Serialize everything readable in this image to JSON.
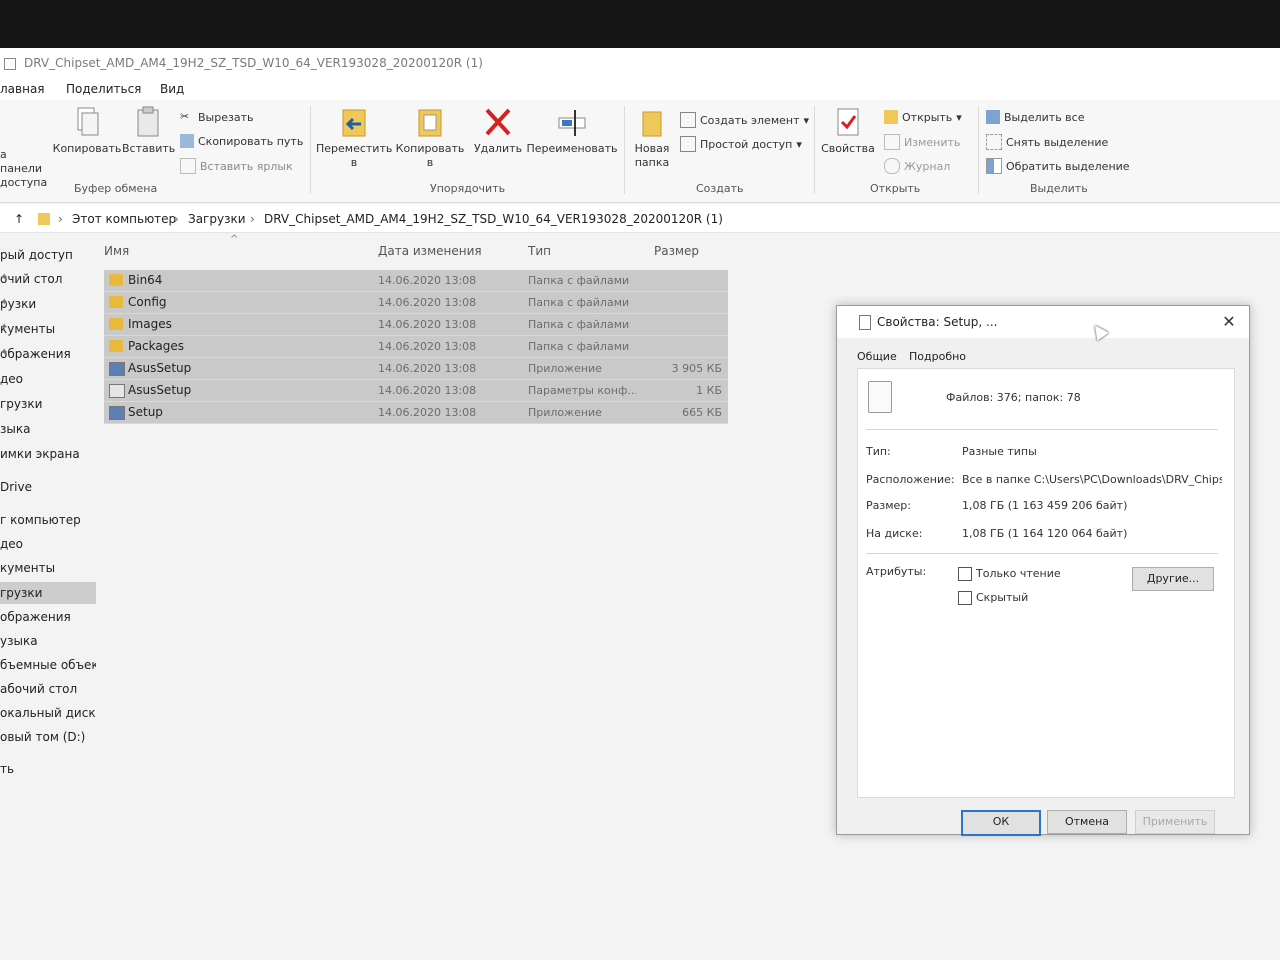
{
  "window": {
    "title": "DRV_Chipset_AMD_AM4_19H2_SZ_TSD_W10_64_VER193028_20200120R (1)"
  },
  "menu_tabs": [
    "лавная",
    "Поделиться",
    "Вид"
  ],
  "ribbon": {
    "clipboard": {
      "pin_label": "а панели доступа",
      "copy_label": "Копировать",
      "paste_label": "Вставить",
      "cut_label": "Вырезать",
      "copy_path_label": "Скопировать путь",
      "paste_shortcut_label": "Вставить ярлык",
      "group_label": "Буфер обмена"
    },
    "organize": {
      "move_label": "Переместить в",
      "copy_to_label": "Копировать в",
      "delete_label": "Удалить",
      "rename_label": "Переименовать",
      "group_label": "Упорядочить"
    },
    "create": {
      "new_folder_label": "Новая папка",
      "new_item_label": "Создать элемент",
      "easy_access_label": "Простой доступ",
      "group_label": "Создать"
    },
    "open": {
      "properties_label": "Свойства",
      "open_label": "Открыть",
      "edit_label": "Изменить",
      "history_label": "Журнал",
      "group_label": "Открыть"
    },
    "select": {
      "select_all_label": "Выделить все",
      "select_none_label": "Снять выделение",
      "invert_label": "Обратить выделение",
      "group_label": "Выделить"
    }
  },
  "address": {
    "crumbs": [
      "Этот компьютер",
      "Загрузки",
      "DRV_Chipset_AMD_AM4_19H2_SZ_TSD_W10_64_VER193028_20200120R (1)"
    ]
  },
  "nav": {
    "items": [
      {
        "label": "рый доступ",
        "pinned": false
      },
      {
        "label": "очий стол",
        "pinned": true
      },
      {
        "label": "рузки",
        "pinned": true
      },
      {
        "label": "кументы",
        "pinned": true
      },
      {
        "label": "ображения",
        "pinned": true
      },
      {
        "label": "део",
        "pinned": false
      },
      {
        "label": "грузки",
        "pinned": false
      },
      {
        "label": "зыка",
        "pinned": false
      },
      {
        "label": "имки экрана",
        "pinned": false
      },
      {
        "label": "Drive",
        "pinned": false
      },
      {
        "label": "г компьютер",
        "pinned": false
      },
      {
        "label": "део",
        "pinned": false
      },
      {
        "label": "кументы",
        "pinned": false
      },
      {
        "label": "грузки",
        "pinned": false
      },
      {
        "label": "ображения",
        "pinned": false
      },
      {
        "label": "узыка",
        "pinned": false
      },
      {
        "label": "бъемные объекты",
        "pinned": false
      },
      {
        "label": "абочий стол",
        "pinned": false
      },
      {
        "label": "окальный диск (C",
        "pinned": false
      },
      {
        "label": "овый том (D:)",
        "pinned": false
      },
      {
        "label": "ть",
        "pinned": false
      }
    ]
  },
  "columns": {
    "name": "Имя",
    "date": "Дата изменения",
    "type": "Тип",
    "size": "Размер"
  },
  "files": [
    {
      "name": "Bin64",
      "date": "14.06.2020 13:08",
      "type": "Папка с файлами",
      "size": "",
      "icon": "folder-icon"
    },
    {
      "name": "Config",
      "date": "14.06.2020 13:08",
      "type": "Папка с файлами",
      "size": "",
      "icon": "folder-icon"
    },
    {
      "name": "Images",
      "date": "14.06.2020 13:08",
      "type": "Папка с файлами",
      "size": "",
      "icon": "folder-icon"
    },
    {
      "name": "Packages",
      "date": "14.06.2020 13:08",
      "type": "Папка с файлами",
      "size": "",
      "icon": "folder-icon"
    },
    {
      "name": "AsusSetup",
      "date": "14.06.2020 13:08",
      "type": "Приложение",
      "size": "3 905 КБ",
      "icon": "app-icon"
    },
    {
      "name": "AsusSetup",
      "date": "14.06.2020 13:08",
      "type": "Параметры конф...",
      "size": "1 КБ",
      "icon": "config-file-icon"
    },
    {
      "name": "Setup",
      "date": "14.06.2020 13:08",
      "type": "Приложение",
      "size": "665 КБ",
      "icon": "setup-icon"
    }
  ],
  "dialog": {
    "title": "Свойства: Setup, ...",
    "tabs": [
      "Общие",
      "Подробно"
    ],
    "summary": "Файлов: 376; папок: 78",
    "props": [
      {
        "label": "Тип:",
        "value": "Разные типы"
      },
      {
        "label": "Расположение:",
        "value": "Все в папке C:\\Users\\PC\\Downloads\\DRV_Chips"
      },
      {
        "label": "Размер:",
        "value": "1,08 ГБ (1 163 459 206 байт)"
      },
      {
        "label": "На диске:",
        "value": "1,08 ГБ (1 164 120 064 байт)"
      }
    ],
    "attributes_label": "Атрибуты:",
    "readonly_label": "Только чтение",
    "hidden_label": "Скрытый",
    "other_button": "Другие...",
    "ok_button": "ОК",
    "cancel_button": "Отмена",
    "apply_button": "Применить"
  }
}
